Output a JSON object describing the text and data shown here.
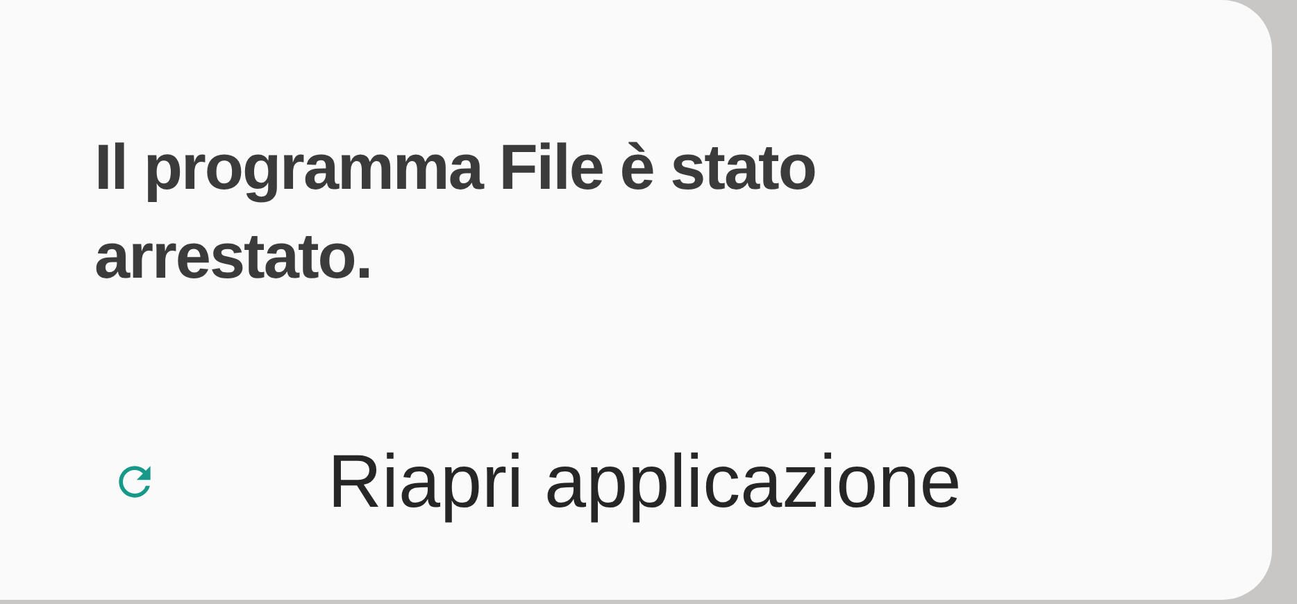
{
  "dialog": {
    "title": "Il programma File è stato arrestato.",
    "actions": [
      {
        "kind": "reopen",
        "label": "Riapri applicazione"
      }
    ]
  }
}
